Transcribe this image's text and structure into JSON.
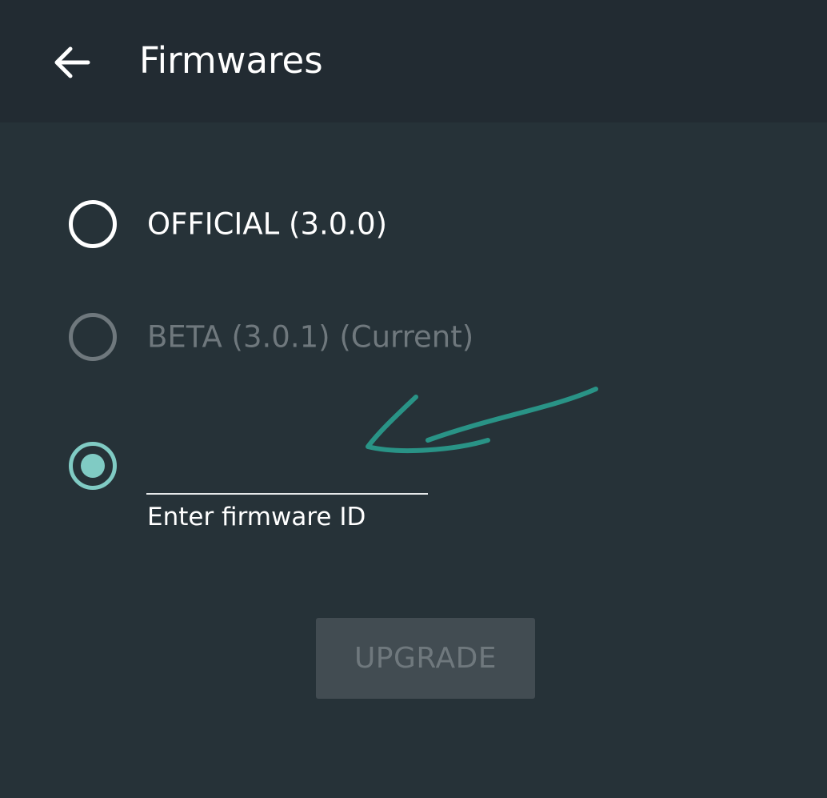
{
  "header": {
    "title": "Firmwares",
    "back_icon": "arrow-left-icon"
  },
  "options": [
    {
      "label": "OFFICIAL (3.0.0)",
      "selected": false,
      "enabled": true
    },
    {
      "label": "BETA (3.0.1) (Current)",
      "selected": false,
      "enabled": false
    },
    {
      "label": "",
      "selected": true,
      "enabled": true
    }
  ],
  "custom_firmware": {
    "value": "",
    "hint": "Enter firmware ID"
  },
  "upgrade_button": {
    "label": "UPGRADE",
    "enabled": false
  },
  "colors": {
    "background": "#263238",
    "app_bar": "#222b32",
    "accent": "#80cbc4",
    "disabled": "#6f787d",
    "button_disabled_bg": "#424c52",
    "annotation": "#2a9d8f"
  },
  "annotation": {
    "icon": "hand-drawn-arrow-icon"
  }
}
